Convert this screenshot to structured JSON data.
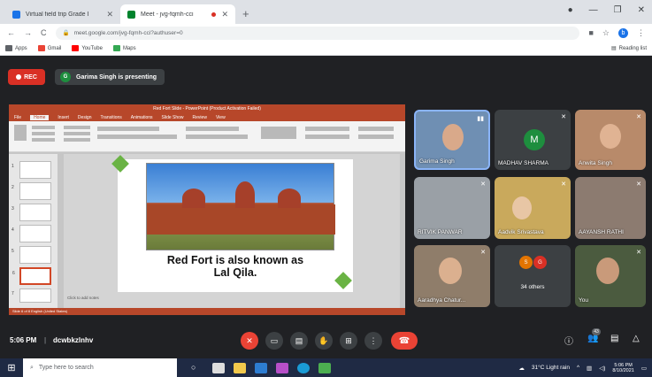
{
  "browser": {
    "tabs": [
      {
        "title": "Virtual field trip Grade I",
        "active": false,
        "favicon_color": "#1a73e8"
      },
      {
        "title": "Meet - jvg-fqmh-cci",
        "active": true,
        "favicon_color": "#00832d"
      }
    ],
    "new_tab_glyph": "+",
    "url": "meet.google.com/jvg-fqmh-cci?authuser=0",
    "avatar_letter": "b",
    "bookmarks": [
      {
        "label": "Apps",
        "icon_color": "#5f6368"
      },
      {
        "label": "Gmail",
        "icon_color": "#ea4335"
      },
      {
        "label": "YouTube",
        "icon_color": "#ff0000"
      },
      {
        "label": "Maps",
        "icon_color": "#34a853"
      }
    ],
    "reading_list": "Reading list"
  },
  "meet": {
    "rec_label": "REC",
    "presenter_initial": "G",
    "presenting_text": "Garima Singh is presenting",
    "time": "5:06 PM",
    "meeting_code": "dcwbkzlnhv",
    "participants_badge": "43"
  },
  "ppt": {
    "title_bar": "Red Fort Slide - PowerPoint (Product Activation Failed)",
    "tabs": [
      "File",
      "Home",
      "Insert",
      "Design",
      "Transitions",
      "Animations",
      "Slide Show",
      "Review",
      "View"
    ],
    "active_tab": "Home",
    "slide_numbers": [
      "1",
      "2",
      "3",
      "4",
      "5",
      "6",
      "7"
    ],
    "slide_text_line1": "Red Fort is also known as",
    "slide_text_line2": "Lal Qila.",
    "notes_placeholder": "Click to add notes",
    "status": "Slide 6 of 8   English (United States)"
  },
  "tiles": [
    {
      "name": "Garima Singh",
      "bg": "#6f8fb3",
      "speaking": true
    },
    {
      "name": "MADHAV SHARMA",
      "bg": "#3c4043",
      "avatar": "M"
    },
    {
      "name": "Anwita Singh",
      "bg": "#b88a6a"
    },
    {
      "name": "RITVIK PANWAR",
      "bg": "#9aa0a6"
    },
    {
      "name": "Aadvik Srivastava",
      "bg": "#c9a95c"
    },
    {
      "name": "AAYANSH RATHI",
      "bg": "#8c7b70"
    },
    {
      "name": "Aaradhya Chatur...",
      "bg": "#8f7d6a"
    },
    {
      "name": "34 others",
      "bg": "#3c4043",
      "avatars": [
        "S",
        "G"
      ]
    },
    {
      "name": "You",
      "bg": "#4b5b3f"
    }
  ],
  "taskbar": {
    "search_placeholder": "Type here to search",
    "weather": "31°C  Light rain",
    "clock_time": "5:06 PM",
    "clock_date": "8/10/2021"
  }
}
